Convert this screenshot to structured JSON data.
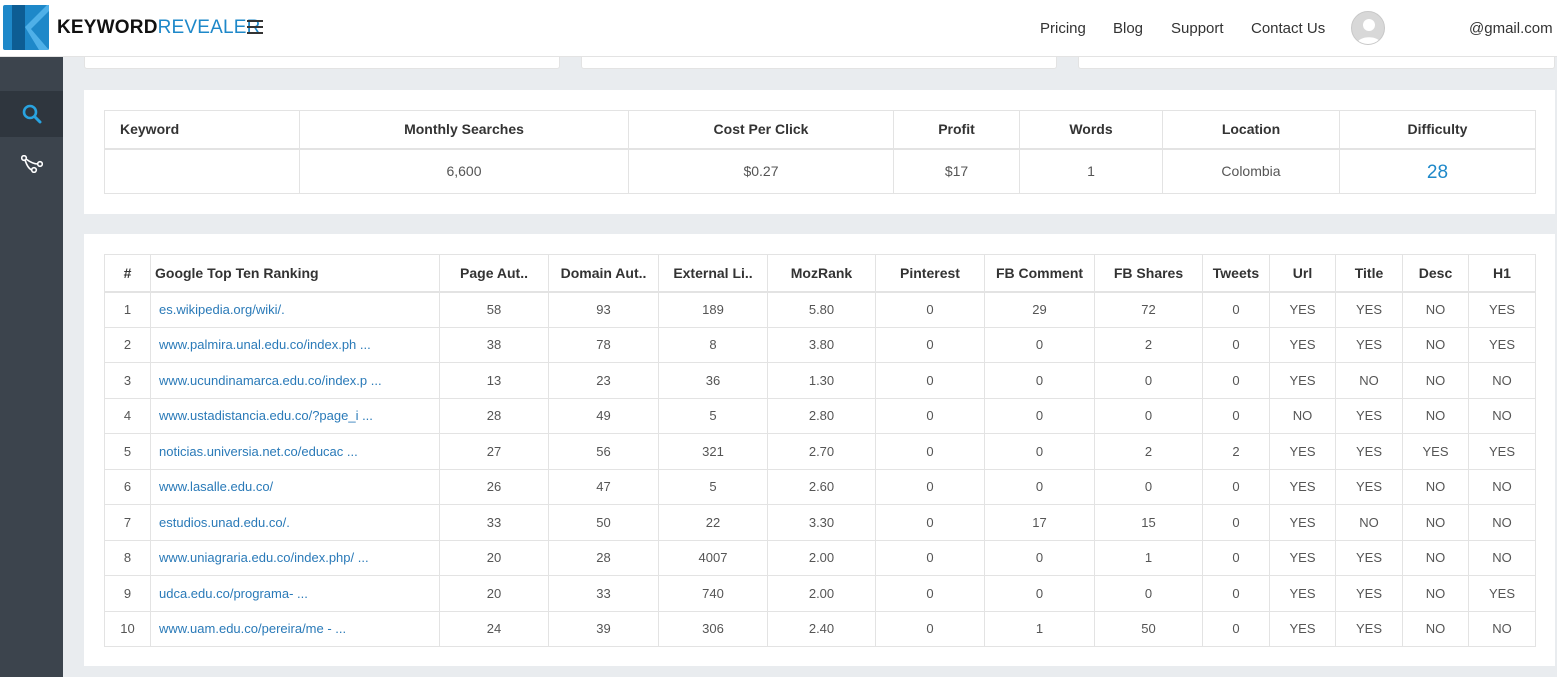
{
  "header": {
    "logo_bold": "KEYWORD",
    "logo_light": "REVEALER",
    "nav": [
      "Pricing",
      "Blog",
      "Support",
      "Contact Us"
    ],
    "user_email": "@gmail.com"
  },
  "colors": {
    "accent": "#1e88c9",
    "sidebar": "#3c444d",
    "link": "#2a7ab8"
  },
  "sidebar": {
    "items": [
      {
        "icon": "search-icon",
        "active": true
      },
      {
        "icon": "share-tree-icon",
        "active": false
      }
    ]
  },
  "keyword_summary": {
    "headers": [
      "Keyword",
      "Monthly Searches",
      "Cost Per Click",
      "Profit",
      "Words",
      "Location",
      "Difficulty"
    ],
    "row": {
      "keyword": "",
      "monthly_searches": "6,600",
      "cpc": "$0.27",
      "profit": "$17",
      "words": "1",
      "location": "Colombia",
      "difficulty": "28"
    }
  },
  "ranking": {
    "headers": [
      "#",
      "Google Top Ten Ranking",
      "Page Aut..",
      "Domain Aut..",
      "External Li..",
      "MozRank",
      "Pinterest",
      "FB Comment",
      "FB Shares",
      "Tweets",
      "Url",
      "Title",
      "Desc",
      "H1"
    ],
    "rows": [
      [
        "1",
        "es.wikipedia.org/wiki/.",
        "58",
        "93",
        "189",
        "5.80",
        "0",
        "29",
        "72",
        "0",
        "YES",
        "YES",
        "NO",
        "YES"
      ],
      [
        "2",
        "www.palmira.unal.edu.co/index.ph ...",
        "38",
        "78",
        "8",
        "3.80",
        "0",
        "0",
        "2",
        "0",
        "YES",
        "YES",
        "NO",
        "YES"
      ],
      [
        "3",
        "www.ucundinamarca.edu.co/index.p ...",
        "13",
        "23",
        "36",
        "1.30",
        "0",
        "0",
        "0",
        "0",
        "YES",
        "NO",
        "NO",
        "NO"
      ],
      [
        "4",
        "www.ustadistancia.edu.co/?page_i ...",
        "28",
        "49",
        "5",
        "2.80",
        "0",
        "0",
        "0",
        "0",
        "NO",
        "YES",
        "NO",
        "NO"
      ],
      [
        "5",
        "noticias.universia.net.co/educac ...",
        "27",
        "56",
        "321",
        "2.70",
        "0",
        "0",
        "2",
        "2",
        "YES",
        "YES",
        "YES",
        "YES"
      ],
      [
        "6",
        "www.lasalle.edu.co/",
        "26",
        "47",
        "5",
        "2.60",
        "0",
        "0",
        "0",
        "0",
        "YES",
        "YES",
        "NO",
        "NO"
      ],
      [
        "7",
        "estudios.unad.edu.co/.",
        "33",
        "50",
        "22",
        "3.30",
        "0",
        "17",
        "15",
        "0",
        "YES",
        "NO",
        "NO",
        "NO"
      ],
      [
        "8",
        "www.uniagraria.edu.co/index.php/ ...",
        "20",
        "28",
        "4007",
        "2.00",
        "0",
        "0",
        "1",
        "0",
        "YES",
        "YES",
        "NO",
        "NO"
      ],
      [
        "9",
        "udca.edu.co/programa- ...",
        "20",
        "33",
        "740",
        "2.00",
        "0",
        "0",
        "0",
        "0",
        "YES",
        "YES",
        "NO",
        "YES"
      ],
      [
        "10",
        "www.uam.edu.co/pereira/me - ...",
        "24",
        "39",
        "306",
        "2.40",
        "0",
        "1",
        "50",
        "0",
        "YES",
        "YES",
        "NO",
        "NO"
      ]
    ]
  }
}
